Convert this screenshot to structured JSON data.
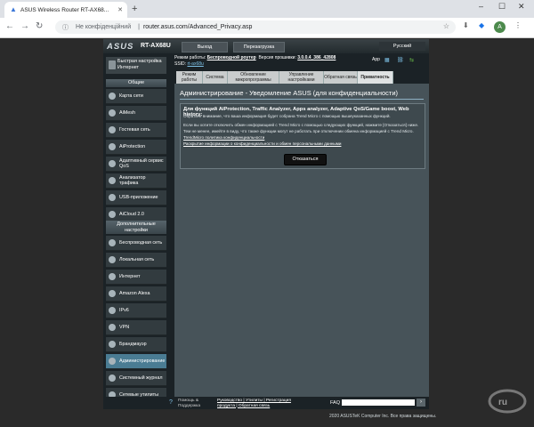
{
  "browser": {
    "tab_title": "ASUS Wireless Router RT-AX68...",
    "secure_label": "Не конфіденційний",
    "url": "router.asus.com/Advanced_Privacy.asp",
    "avatar_letter": "A"
  },
  "router": {
    "logo": "ASUS",
    "model": "RT-AX68U",
    "logout": "Выход",
    "reboot": "Перезагрузка",
    "language": "Русский",
    "mode_label": "Режим работы:",
    "mode_value": "Беспроводной роутер",
    "fw_label": "Версия прошивки:",
    "fw_value": "3.0.0.4_386_42808",
    "ssid_label": "SSID:",
    "ssid_value": "rt-ax68u",
    "app_label": "App"
  },
  "sidebar": {
    "qis": "Быстрая настройка Интернет",
    "general_title": "Общие",
    "general_items": [
      "Карта сети",
      "AiMesh",
      "Гостевая сеть",
      "AiProtection",
      "Адаптивный сервис QoS",
      "Анализатор трафика",
      "USB-приложение",
      "AiCloud 2.0"
    ],
    "advanced_title": "Дополнительные настройки",
    "advanced_items": [
      "Беспроводная сеть",
      "Локальная сеть",
      "Интернет",
      "Amazon Alexa",
      "IPv6",
      "VPN",
      "Брандмауэр",
      "Администрирование",
      "Системный журнал",
      "Сетевые утилиты"
    ]
  },
  "tabs": [
    "Режим работы",
    "Система",
    "Обновление микропрограммы",
    "Управление настройками",
    "Обратная связь",
    "Приватность"
  ],
  "panel": {
    "title": "Администрирование - Уведомление ASUS (для конфиденциальности)",
    "box_title": "Для функций AiProtection, Traffic Analyzer, Apps analyzer, Adaptive QoS/Game boost, Web history:",
    "line1": "Обратите внимание, что ваша информация будет собрана Trend Micro с помощью вышеуказанных функций.",
    "line2": "Если вы хотите отключить обмен информацией с Trend Micro с помощью следующих функций, нажмите [Отказаться] ниже.",
    "line3": "Тем не менее, имейте в виду, что также функции могут не работать при отключении обмена информацией с Trend Micro.",
    "link1": "TrendMicro политика конфиденциальности",
    "link2": "Раскрытие информации о конфиденциальности и обмен персональными данными",
    "decline": "Отказаться"
  },
  "footer": {
    "help": "Помощь & Поддержка",
    "links_row1": "Руководство | Утилиты | Регистрация",
    "links_row2": "продукта | Обратная связь",
    "faq": "FAQ",
    "copyright": "2020 ASUSTeK Computer Inc. Все права защищены."
  },
  "colors": {
    "accent": "#4a7c93",
    "panel": "#475359",
    "bg": "#2a2a2a"
  }
}
